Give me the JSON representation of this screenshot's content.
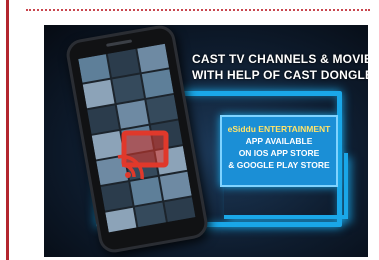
{
  "banner": {
    "headline_line1": "CAST TV CHANNELS & MOVIES",
    "headline_line2": "WITH HELP OF CAST DONGLE",
    "store_box": {
      "brand": "eSiddu ENTERTAINMENT",
      "line2": "APP AVAILABLE",
      "line3": "ON IOS APP STORE",
      "line4": "& GOOGLE PLAY STORE"
    }
  },
  "icons": {
    "cast": "cast-icon",
    "phone": "smartphone-icon"
  },
  "colors": {
    "accent_blue": "#1aa7e8",
    "cast_red": "#e0392b",
    "left_rule": "#b3262e"
  }
}
